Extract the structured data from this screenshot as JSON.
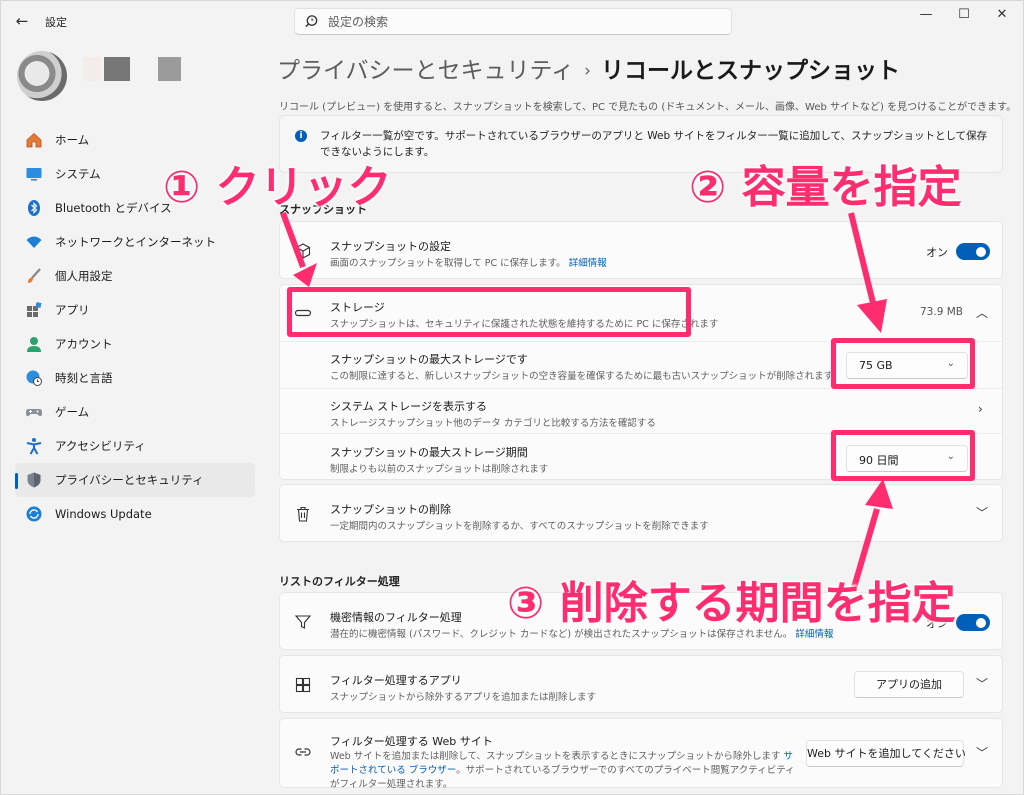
{
  "window": {
    "app_title": "設定",
    "search_placeholder": "設定の検索",
    "controls": {
      "minimize": "—",
      "maximize": "☐",
      "close": "✕"
    }
  },
  "sidebar": {
    "items": [
      {
        "label": "ホーム",
        "icon": "home-icon"
      },
      {
        "label": "システム",
        "icon": "system-icon"
      },
      {
        "label": "Bluetooth とデバイス",
        "icon": "bluetooth-icon"
      },
      {
        "label": "ネットワークとインターネット",
        "icon": "wifi-icon"
      },
      {
        "label": "個人用設定",
        "icon": "brush-icon"
      },
      {
        "label": "アプリ",
        "icon": "apps-icon"
      },
      {
        "label": "アカウント",
        "icon": "account-icon"
      },
      {
        "label": "時刻と言語",
        "icon": "globe-clock-icon"
      },
      {
        "label": "ゲーム",
        "icon": "gamepad-icon"
      },
      {
        "label": "アクセシビリティ",
        "icon": "accessibility-icon"
      },
      {
        "label": "プライバシーとセキュリティ",
        "icon": "shield-icon",
        "active": true
      },
      {
        "label": "Windows Update",
        "icon": "update-icon"
      }
    ]
  },
  "main": {
    "breadcrumb": {
      "parent": "プライバシーとセキュリティ",
      "separator": "›",
      "current": "リコールとスナップショット"
    },
    "description": "リコール (プレビュー) を使用すると、スナップショットを検索して、PC で見たもの (ドキュメント、メール、画像、Web サイトなど) を見つけることができます。",
    "info_bar": "フィルター一覧が空です。サポートされているブラウザーのアプリと Web サイトをフィルター一覧に追加して、スナップショットとして保存できないようにします。",
    "snapshots_section": {
      "title": "スナップショット",
      "settings": {
        "title": "スナップショットの設定",
        "subtitle": "画面のスナップショットを取得して PC に保存します。",
        "link": "詳細情報",
        "toggle_label": "オン"
      },
      "storage": {
        "title": "ストレージ",
        "subtitle": "スナップショットは、セキュリティに保護された状態を維持するために PC に保存されます",
        "size": "73.9 MB",
        "max_storage": {
          "title": "スナップショットの最大ストレージです",
          "subtitle": "この制限に達すると、新しいスナップショットの空き容量を確保するために最も古いスナップショットが削除されます",
          "value": "75 GB"
        },
        "system_storage": {
          "title": "システム ストレージを表示する",
          "subtitle": "ストレージスナップショット他のデータ カテゴリと比較する方法を確認する"
        },
        "max_period": {
          "title": "スナップショットの最大ストレージ期間",
          "subtitle": "制限よりも以前のスナップショットは削除されます",
          "value": "90 日間"
        }
      },
      "delete": {
        "title": "スナップショットの削除",
        "subtitle": "一定期間内のスナップショットを削除するか、すべてのスナップショットを削除できます"
      }
    },
    "filter_section": {
      "title": "リストのフィルター処理",
      "sensitive": {
        "title": "機密情報のフィルター処理",
        "subtitle": "潜在的に機密情報 (パスワード、クレジット カードなど) が検出されたスナップショットは保存されません。",
        "link": "詳細情報",
        "toggle_label": "オン"
      },
      "apps": {
        "title": "フィルター処理するアプリ",
        "subtitle": "スナップショットから除外するアプリを追加または削除します",
        "button": "アプリの追加"
      },
      "websites": {
        "title": "フィルター処理する Web サイト",
        "subtitle_1": "Web サイトを追加または削除して、スナップショットを表示するときにスナップショットから除外します ",
        "link": "サポートされている ブラウザー",
        "subtitle_2": "。サポートされているブラウザーでのすべてのプライベート閲覧アクティビティがフィルター処理されます。",
        "button": "Web サイトを追加してください"
      }
    }
  },
  "annotations": {
    "step1": "① クリック",
    "step2": "② 容量を指定",
    "step3": "③ 削除する期間を指定",
    "color": "#ff2c6f"
  }
}
